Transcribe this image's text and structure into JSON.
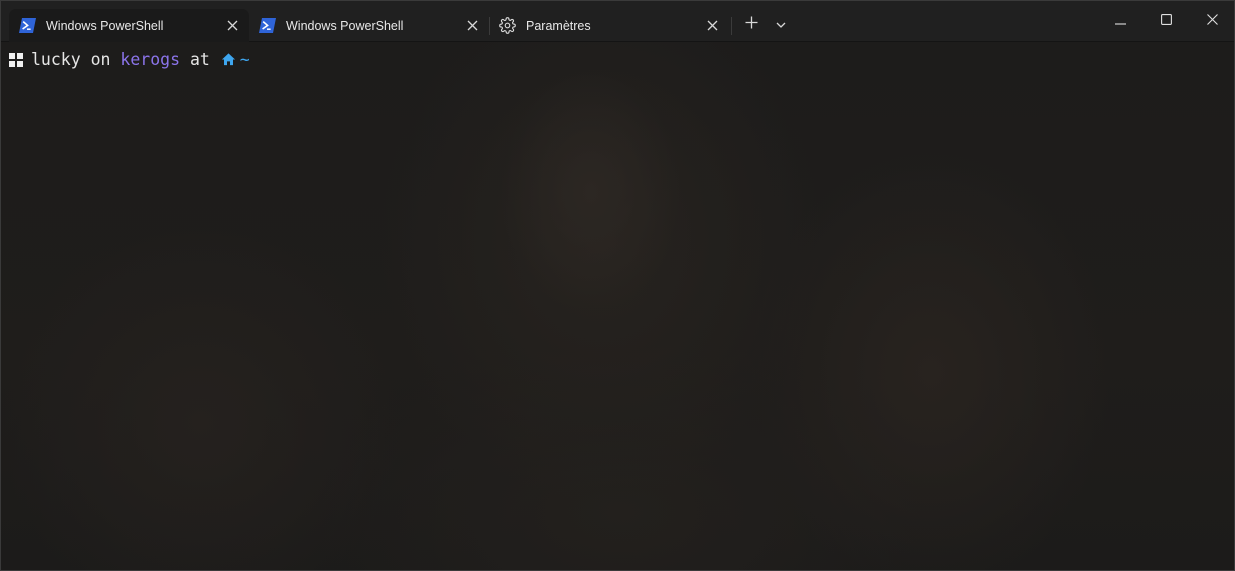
{
  "tabs": [
    {
      "title": "Windows PowerShell",
      "icon": "powershell-icon",
      "active": true
    },
    {
      "title": "Windows PowerShell",
      "icon": "powershell-icon",
      "active": false
    },
    {
      "title": "Paramètres",
      "icon": "gear-icon",
      "active": false
    }
  ],
  "tab_strip": {
    "new_tab_icon": "plus-icon",
    "dropdown_icon": "chevron-down-icon"
  },
  "window_controls": [
    "minimize-icon",
    "maximize-icon",
    "close-icon"
  ],
  "prompt": {
    "user": "lucky",
    "on": " on ",
    "host": "kerogs",
    "at": " at ",
    "path": "~"
  },
  "colors": {
    "host": "#8b74ea",
    "path": "#3ea6ef",
    "powershell_icon": "#2f64d8"
  }
}
